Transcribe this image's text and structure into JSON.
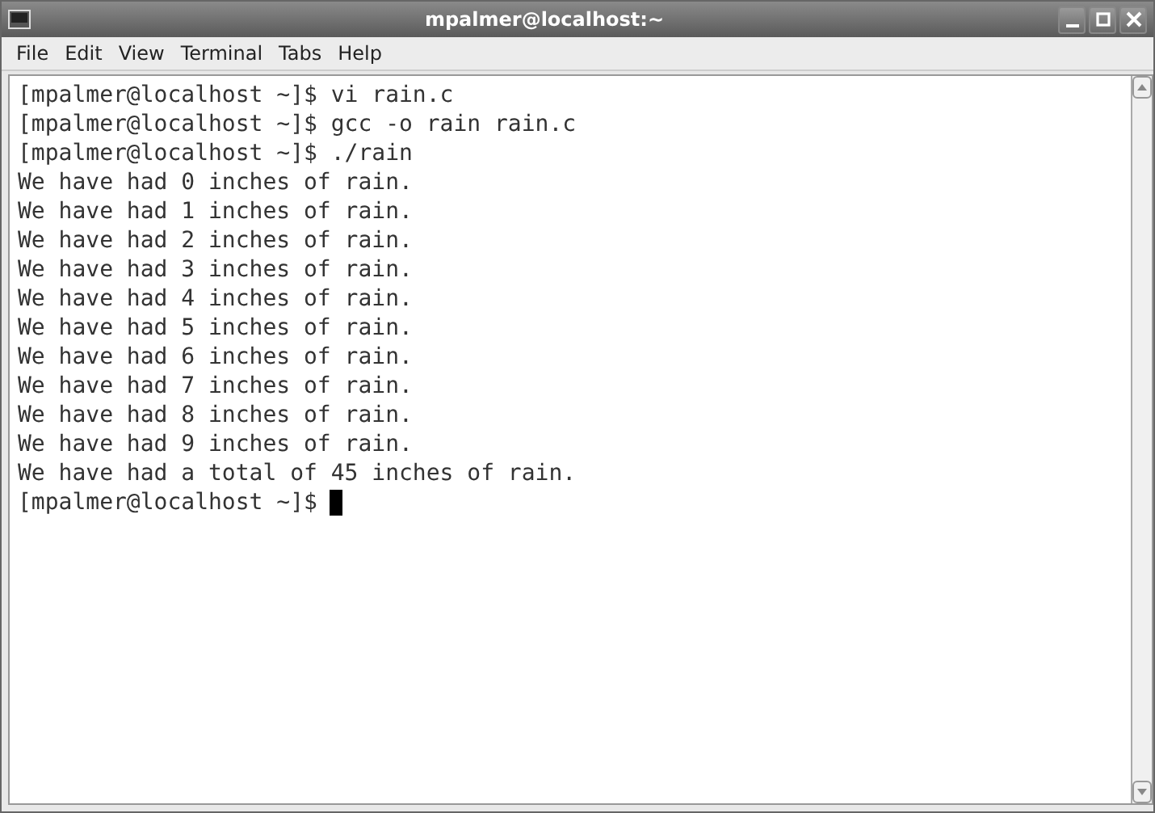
{
  "window": {
    "title": "mpalmer@localhost:~"
  },
  "menu": [
    "File",
    "Edit",
    "View",
    "Terminal",
    "Tabs",
    "Help"
  ],
  "terminal": {
    "lines": [
      "[mpalmer@localhost ~]$ vi rain.c",
      "[mpalmer@localhost ~]$ gcc -o rain rain.c",
      "[mpalmer@localhost ~]$ ./rain",
      "We have had 0 inches of rain.",
      "We have had 1 inches of rain.",
      "We have had 2 inches of rain.",
      "We have had 3 inches of rain.",
      "We have had 4 inches of rain.",
      "We have had 5 inches of rain.",
      "We have had 6 inches of rain.",
      "We have had 7 inches of rain.",
      "We have had 8 inches of rain.",
      "We have had 9 inches of rain.",
      "We have had a total of 45 inches of rain."
    ],
    "prompt": "[mpalmer@localhost ~]$"
  }
}
